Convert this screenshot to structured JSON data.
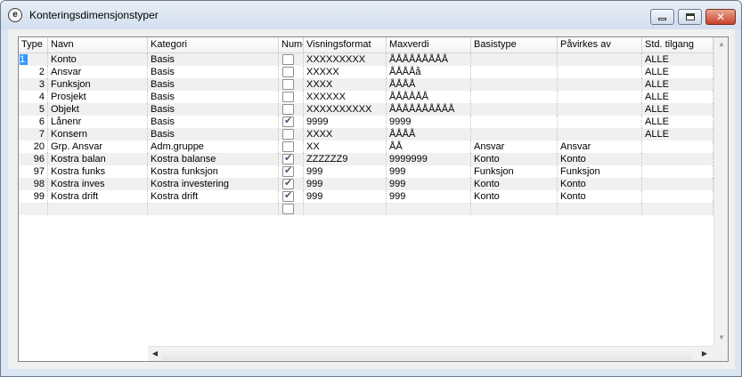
{
  "window": {
    "title": "Konteringsdimensjonstyper",
    "app_icon_glyph": "e",
    "buttons": {
      "minimize": "minimize-icon",
      "maximize": "maximize-icon",
      "close": "✕"
    }
  },
  "columns": [
    "Type",
    "Navn",
    "Kategori",
    "Nume",
    "Visningsformat",
    "Maxverdi",
    "Basistype",
    "Påvirkes av",
    "Std. tilgang"
  ],
  "rows": [
    {
      "type": "1",
      "navn": "Konto",
      "kategori": "Basis",
      "numerisk": false,
      "visningsformat": "XXXXXXXXX",
      "maxverdi": "ÅÅÅÅÅÅÅÅÅ",
      "basistype": "",
      "pavirkes": "",
      "tilgang": "ALLE"
    },
    {
      "type": "2",
      "navn": "Ansvar",
      "kategori": "Basis",
      "numerisk": false,
      "visningsformat": "XXXXX",
      "maxverdi": "ÅÅÅÅå",
      "basistype": "",
      "pavirkes": "",
      "tilgang": "ALLE"
    },
    {
      "type": "3",
      "navn": "Funksjon",
      "kategori": "Basis",
      "numerisk": false,
      "visningsformat": "XXXX",
      "maxverdi": "ÅÅÅÅ",
      "basistype": "",
      "pavirkes": "",
      "tilgang": "ALLE"
    },
    {
      "type": "4",
      "navn": "Prosjekt",
      "kategori": "Basis",
      "numerisk": false,
      "visningsformat": "XXXXXX",
      "maxverdi": "ÅÅÅÅÅÅ",
      "basistype": "",
      "pavirkes": "",
      "tilgang": "ALLE"
    },
    {
      "type": "5",
      "navn": "Objekt",
      "kategori": "Basis",
      "numerisk": false,
      "visningsformat": "XXXXXXXXXX",
      "maxverdi": "ÅÅÅÅÅÅÅÅÅÅ",
      "basistype": "",
      "pavirkes": "",
      "tilgang": "ALLE"
    },
    {
      "type": "6",
      "navn": "Lånenr",
      "kategori": "Basis",
      "numerisk": true,
      "visningsformat": "9999",
      "maxverdi": "9999",
      "basistype": "",
      "pavirkes": "",
      "tilgang": "ALLE"
    },
    {
      "type": "7",
      "navn": "Konsern",
      "kategori": "Basis",
      "numerisk": false,
      "visningsformat": "XXXX",
      "maxverdi": "ÅÅÅÅ",
      "basistype": "",
      "pavirkes": "",
      "tilgang": "ALLE"
    },
    {
      "type": "20",
      "navn": "Grp. Ansvar",
      "kategori": "Adm.gruppe",
      "numerisk": false,
      "visningsformat": "XX",
      "maxverdi": "ÅÅ",
      "basistype": "Ansvar",
      "pavirkes": "Ansvar",
      "tilgang": ""
    },
    {
      "type": "96",
      "navn": "Kostra balan",
      "kategori": "Kostra balanse",
      "numerisk": true,
      "visningsformat": "ZZZZZZ9",
      "maxverdi": "9999999",
      "basistype": "Konto",
      "pavirkes": "Konto",
      "tilgang": ""
    },
    {
      "type": "97",
      "navn": "Kostra funks",
      "kategori": "Kostra funksjon",
      "numerisk": true,
      "visningsformat": "999",
      "maxverdi": "999",
      "basistype": "Funksjon",
      "pavirkes": "Funksjon",
      "tilgang": ""
    },
    {
      "type": "98",
      "navn": "Kostra inves",
      "kategori": "Kostra investering",
      "numerisk": true,
      "visningsformat": "999",
      "maxverdi": "999",
      "basistype": "Konto",
      "pavirkes": "Konto",
      "tilgang": ""
    },
    {
      "type": "99",
      "navn": "Kostra drift",
      "kategori": "Kostra drift",
      "numerisk": true,
      "visningsformat": "999",
      "maxverdi": "999",
      "basistype": "Konto",
      "pavirkes": "Konto",
      "tilgang": ""
    },
    {
      "type": "",
      "navn": "",
      "kategori": "",
      "numerisk": false,
      "visningsformat": "",
      "maxverdi": "",
      "basistype": "",
      "pavirkes": "",
      "tilgang": ""
    }
  ],
  "colors": {
    "selection": "#3399ff",
    "alt_row": "#f0f0f0",
    "window_frame": "#dbe6f3",
    "close_button": "#c8412a"
  }
}
